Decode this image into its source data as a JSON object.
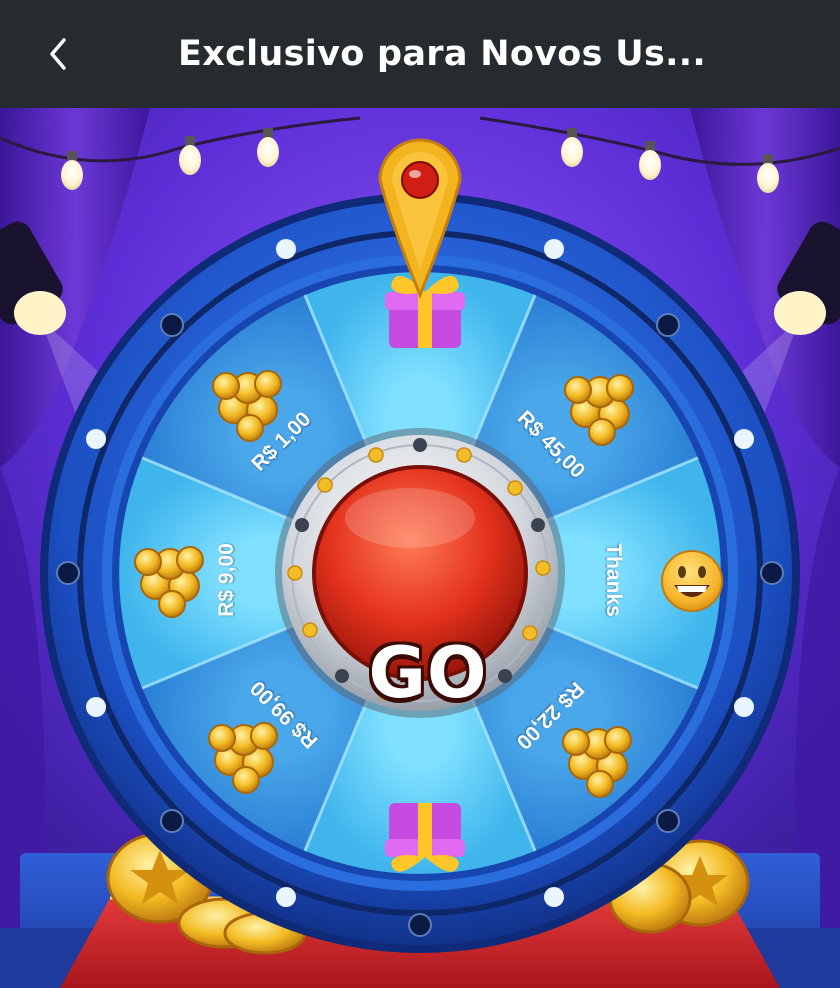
{
  "header": {
    "title": "Exclusivo para Novos Us...",
    "back_icon": "chevron-left-icon"
  },
  "wheel": {
    "go_label": "GO",
    "segments": [
      {
        "label": "",
        "prize": "gift-box-icon"
      },
      {
        "label": "R$ 45,00",
        "prize": "gold-coins-icon"
      },
      {
        "label": "Thanks",
        "prize": "smiley-face-icon"
      },
      {
        "label": "R$ 22,00",
        "prize": "gold-coins-icon"
      },
      {
        "label": "",
        "prize": "gift-box-icon"
      },
      {
        "label": "R$ 99,00",
        "prize": "gold-coins-icon"
      },
      {
        "label": "R$ 9,00",
        "prize": "gold-coins-icon"
      },
      {
        "label": "R$ 1,00",
        "prize": "gold-coins-icon"
      }
    ],
    "pointer_icon": "pointer-pin-icon"
  },
  "colors": {
    "header_bg": "#262b2f",
    "stage_purple": "#6a34e0",
    "wheel_rim": "#1c55c8",
    "segment_light": "#4cc3ee",
    "segment_dark": "#2b8fd8",
    "go_button": "#d9301c",
    "gold": "#f2b824"
  }
}
